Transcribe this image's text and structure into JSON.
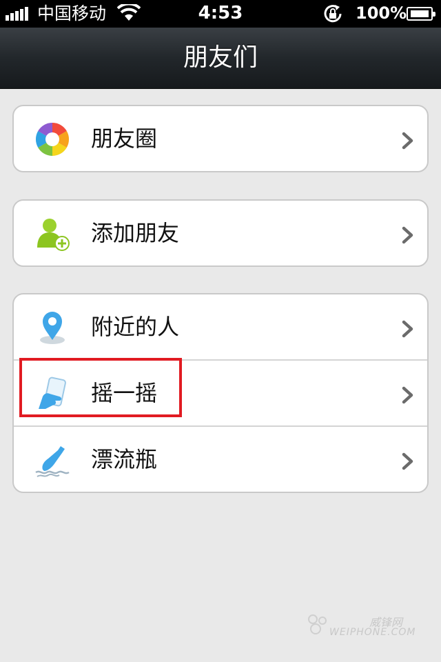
{
  "status_bar": {
    "carrier": "中国移动",
    "time": "4:53",
    "battery_percent": "100%",
    "signal_bars": 5,
    "icons": [
      "signal-icon",
      "wifi-icon",
      "orientation-lock-icon",
      "battery-charging-icon"
    ]
  },
  "nav": {
    "title": "朋友们"
  },
  "groups": [
    {
      "items": [
        {
          "label": "朋友圈",
          "icon": "moments-aperture-icon"
        }
      ]
    },
    {
      "items": [
        {
          "label": "添加朋友",
          "icon": "add-friend-icon"
        }
      ]
    },
    {
      "items": [
        {
          "label": "附近的人",
          "icon": "location-pin-icon"
        },
        {
          "label": "摇一摇",
          "icon": "shake-phone-icon",
          "highlighted": true
        },
        {
          "label": "漂流瓶",
          "icon": "drift-bottle-icon"
        }
      ]
    }
  ],
  "watermark": {
    "line1": "威锋网",
    "line2": "WEIPHONE.COM"
  },
  "colors": {
    "highlight": "#e11b22",
    "background": "#e9e9e9",
    "navbar": "#22272b"
  }
}
